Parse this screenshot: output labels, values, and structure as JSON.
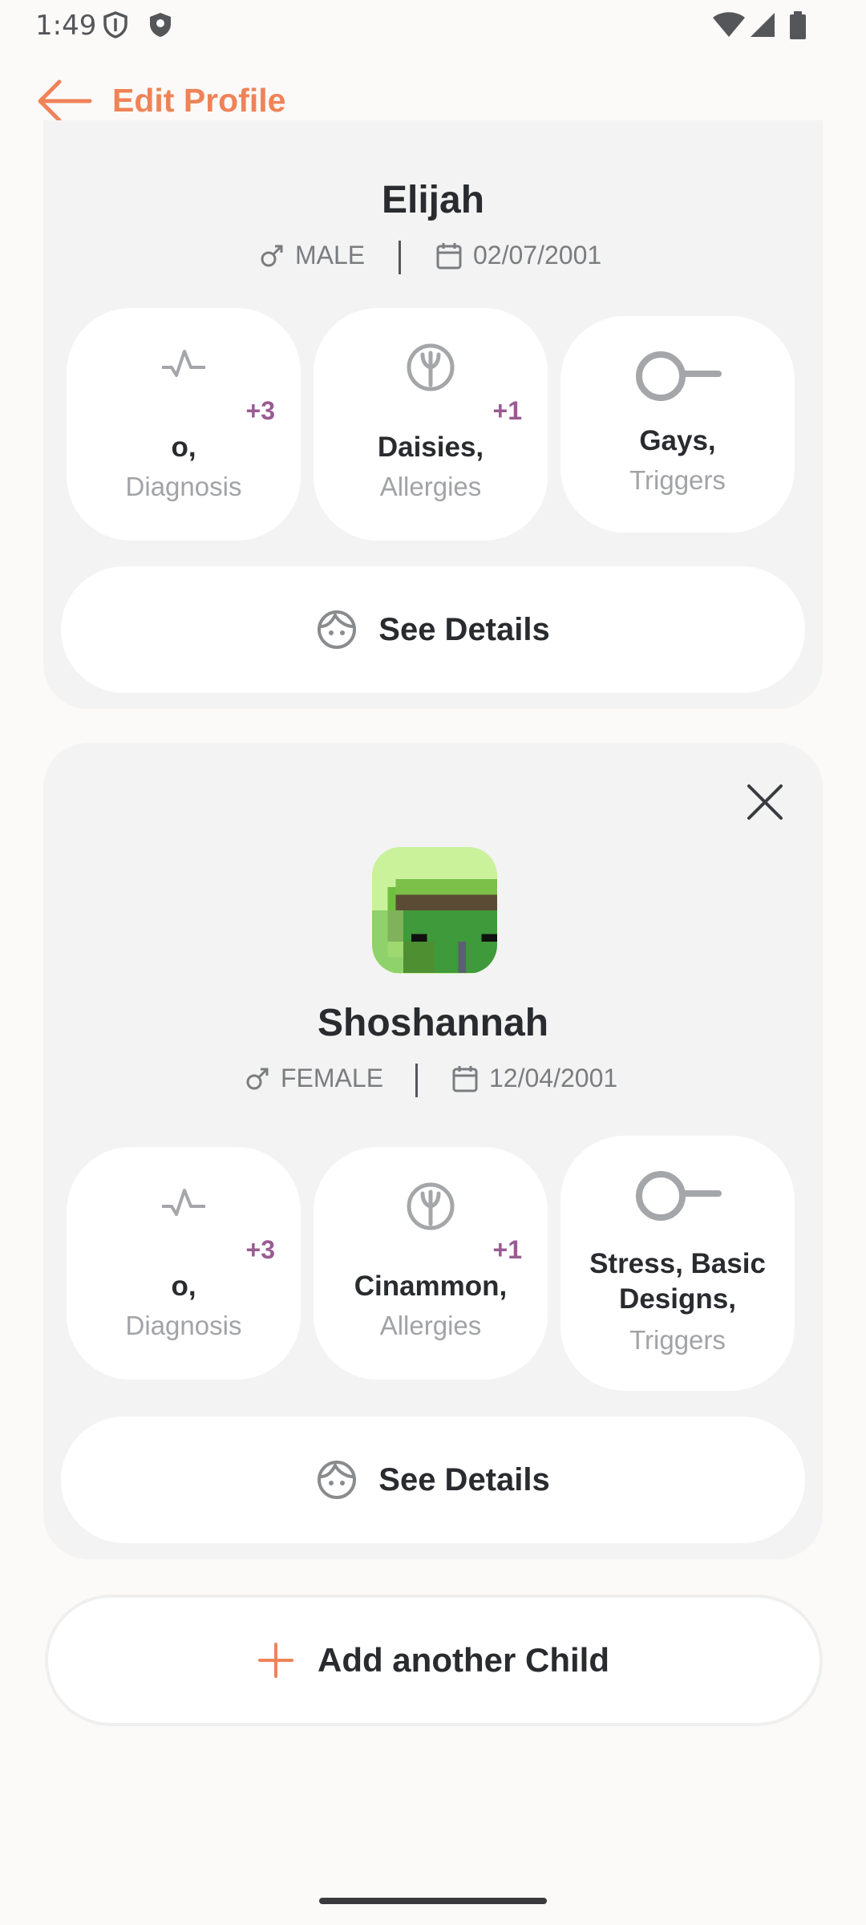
{
  "status_bar": {
    "time": "1:49",
    "icons": [
      "privacy-shield-icon",
      "shield-icon",
      "wifi-icon",
      "signal-icon",
      "battery-icon"
    ]
  },
  "header": {
    "back_icon": "arrow-left-icon",
    "title": "Edit Profile"
  },
  "children": [
    {
      "name": "Elijah",
      "gender": "MALE",
      "birthdate": "02/07/2001",
      "diagnosis": {
        "value": "o,",
        "label": "Diagnosis",
        "more": "+3"
      },
      "allergies": {
        "value": "Daisies,",
        "label": "Allergies",
        "more": "+1"
      },
      "triggers": {
        "value": "Gays,",
        "label": "Triggers"
      },
      "details_label": "See Details"
    },
    {
      "name": "Shoshannah",
      "gender": "FEMALE",
      "birthdate": "12/04/2001",
      "diagnosis": {
        "value": "o,",
        "label": "Diagnosis",
        "more": "+3"
      },
      "allergies": {
        "value": "Cinammon,",
        "label": "Allergies",
        "more": "+1"
      },
      "triggers": {
        "value": "Stress, Basic Designs,",
        "label": "Triggers"
      },
      "details_label": "See Details"
    }
  ],
  "add_child_label": "Add another Child",
  "colors": {
    "accent": "#ef8358",
    "count_purple": "#9a5b93",
    "card_bg": "#f3f3f3",
    "page_bg": "#fbfaf8"
  }
}
